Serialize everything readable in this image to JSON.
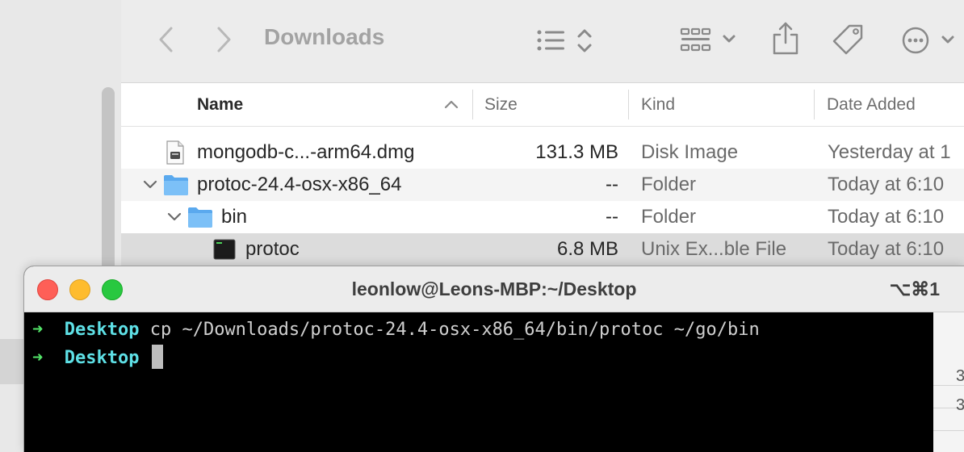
{
  "finder": {
    "title": "Downloads",
    "columns": {
      "name": "Name",
      "size": "Size",
      "kind": "Kind",
      "date_added": "Date Added"
    },
    "rows": [
      {
        "name": "mongodb-c...-arm64.dmg",
        "size": "131.3 MB",
        "kind": "Disk Image",
        "date": "Yesterday at 1",
        "icon": "disk-image-icon"
      },
      {
        "name": "protoc-24.4-osx-x86_64",
        "size": "--",
        "kind": "Folder",
        "date": "Today at 6:10",
        "icon": "folder-icon"
      },
      {
        "name": "bin",
        "size": "--",
        "kind": "Folder",
        "date": "Today at 6:10",
        "icon": "folder-icon"
      },
      {
        "name": "protoc",
        "size": "6.8 MB",
        "kind": "Unix Ex...ble File",
        "date": "Today at 6:10",
        "icon": "unix-executable-icon"
      }
    ]
  },
  "terminal": {
    "title": "leonlow@Leons-MBP:~/Desktop",
    "shortcut": "⌥⌘1",
    "lines": [
      {
        "arrow": "➜",
        "dir": "Desktop",
        "command": "cp ~/Downloads/protoc-24.4-osx-x86_64/bin/protoc ~/go/bin"
      },
      {
        "arrow": "➜",
        "dir": "Desktop",
        "command": ""
      }
    ],
    "scroll_chars": [
      "3",
      "3"
    ]
  },
  "colors": {
    "prompt_arrow": "#54e66a",
    "prompt_dir": "#5ee0e6",
    "folder": "#6bb5f5",
    "traffic_red": "#fe5f57",
    "traffic_yellow": "#febc2e",
    "traffic_green": "#28c840"
  }
}
